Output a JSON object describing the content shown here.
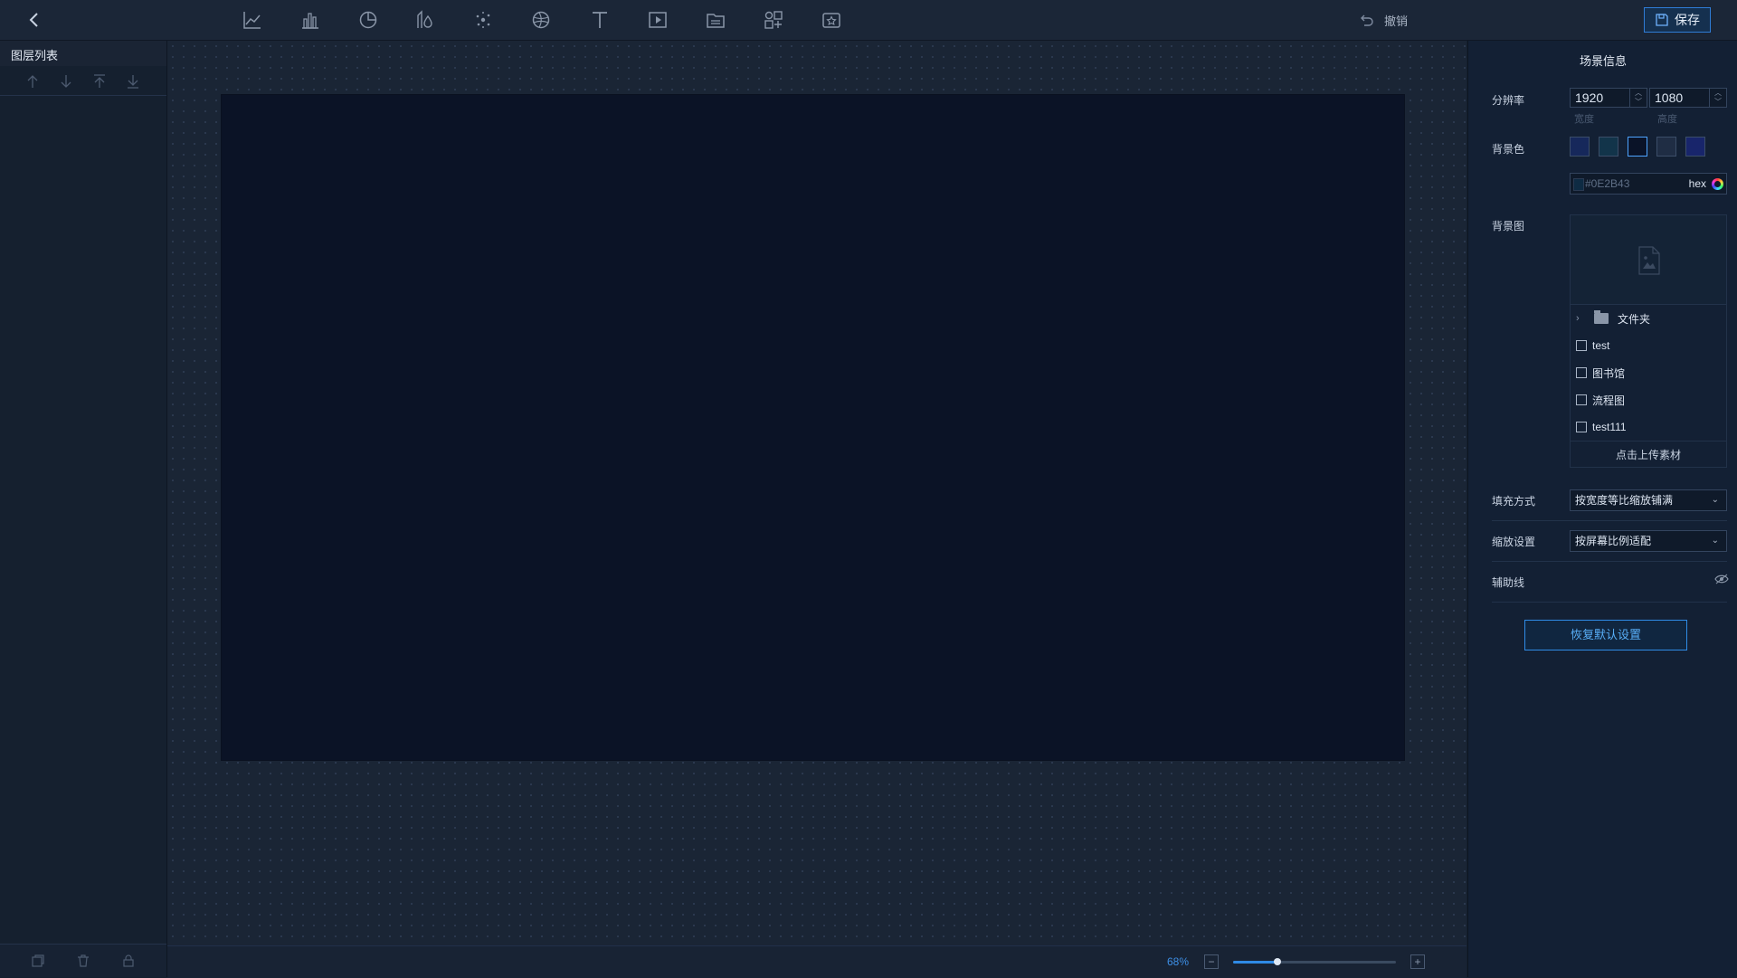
{
  "toolbar": {
    "tools": [
      "line-chart-icon",
      "bar-chart-icon",
      "pie-chart-icon",
      "map-pin-icon",
      "scatter-icon",
      "globe-icon",
      "text-icon",
      "media-icon",
      "folder-icon",
      "widget-icon",
      "favorite-icon"
    ],
    "undo_label": "撤销",
    "save_label": "保存"
  },
  "layers": {
    "title": "图层列表"
  },
  "canvas": {
    "zoom_label": "68%",
    "zoom_minus": "−",
    "zoom_plus": "+",
    "zoom_level": 0.27
  },
  "scene": {
    "title": "场景信息",
    "resolution_label": "分辨率",
    "width_value": "1920",
    "height_value": "1080",
    "width_label": "宽度",
    "height_label": "高度",
    "bg_color_label": "背景色",
    "swatches": [
      "#16285b",
      "#12344a",
      "#0a1328",
      "#1f2d44",
      "#18256b"
    ],
    "hex_value": "#0E2B43",
    "hex_label": "hex",
    "bg_image_label": "背景图",
    "folder_label": "文件夹",
    "materials": [
      "test",
      "图书馆",
      "流程图",
      "test111"
    ],
    "upload_label": "点击上传素材",
    "fill_label": "填充方式",
    "fill_value": "按宽度等比缩放铺满",
    "scale_label": "缩放设置",
    "scale_value": "按屏幕比例适配",
    "guide_label": "辅助线",
    "restore_label": "恢复默认设置"
  }
}
